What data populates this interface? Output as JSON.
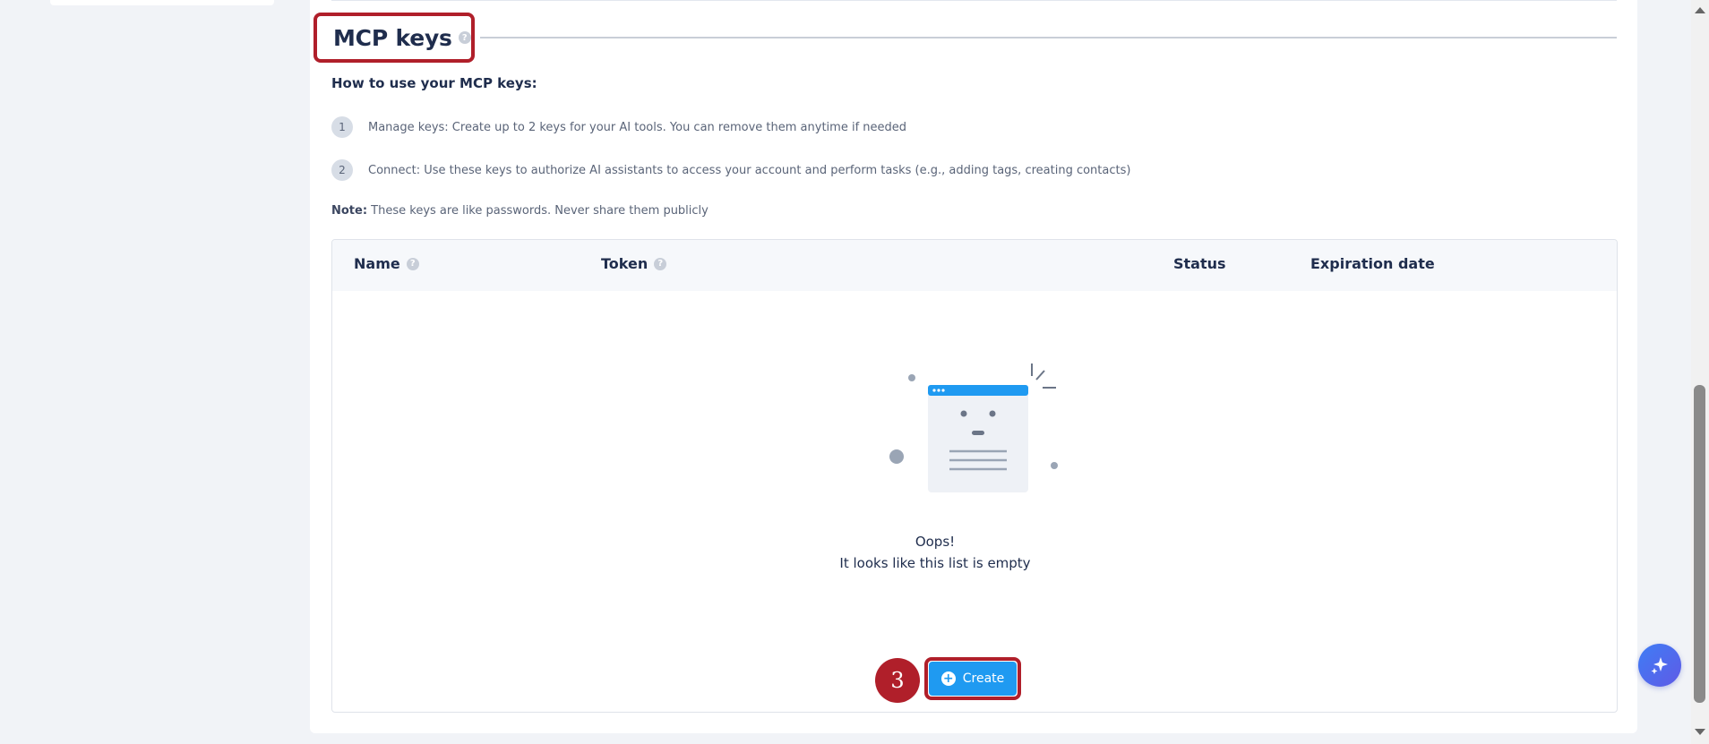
{
  "section": {
    "title": "MCP keys",
    "help": "?"
  },
  "how_to": {
    "title": "How to use your MCP keys:",
    "steps": [
      {
        "num": "1",
        "text": "Manage keys: Create up to 2 keys for your AI tools. You can remove them anytime if needed"
      },
      {
        "num": "2",
        "text": "Connect: Use these keys to authorize AI assistants to access your account and perform tasks (e.g., adding tags, creating contacts)"
      }
    ]
  },
  "note": {
    "label": "Note:",
    "text": " These keys are like passwords. Never share them publicly"
  },
  "table": {
    "columns": [
      "Name",
      "Token",
      "Status",
      "Expiration date"
    ],
    "help": "?",
    "empty_title": "Oops!",
    "empty_subtitle": "It looks like this list is empty"
  },
  "create_button": {
    "label": "Create",
    "icon": "plus-circle-icon"
  },
  "annotation": {
    "step_number": "3"
  },
  "colors": {
    "accent": "#1f9af1",
    "annotation": "#b01f2a",
    "heading": "#1f2d4d"
  }
}
